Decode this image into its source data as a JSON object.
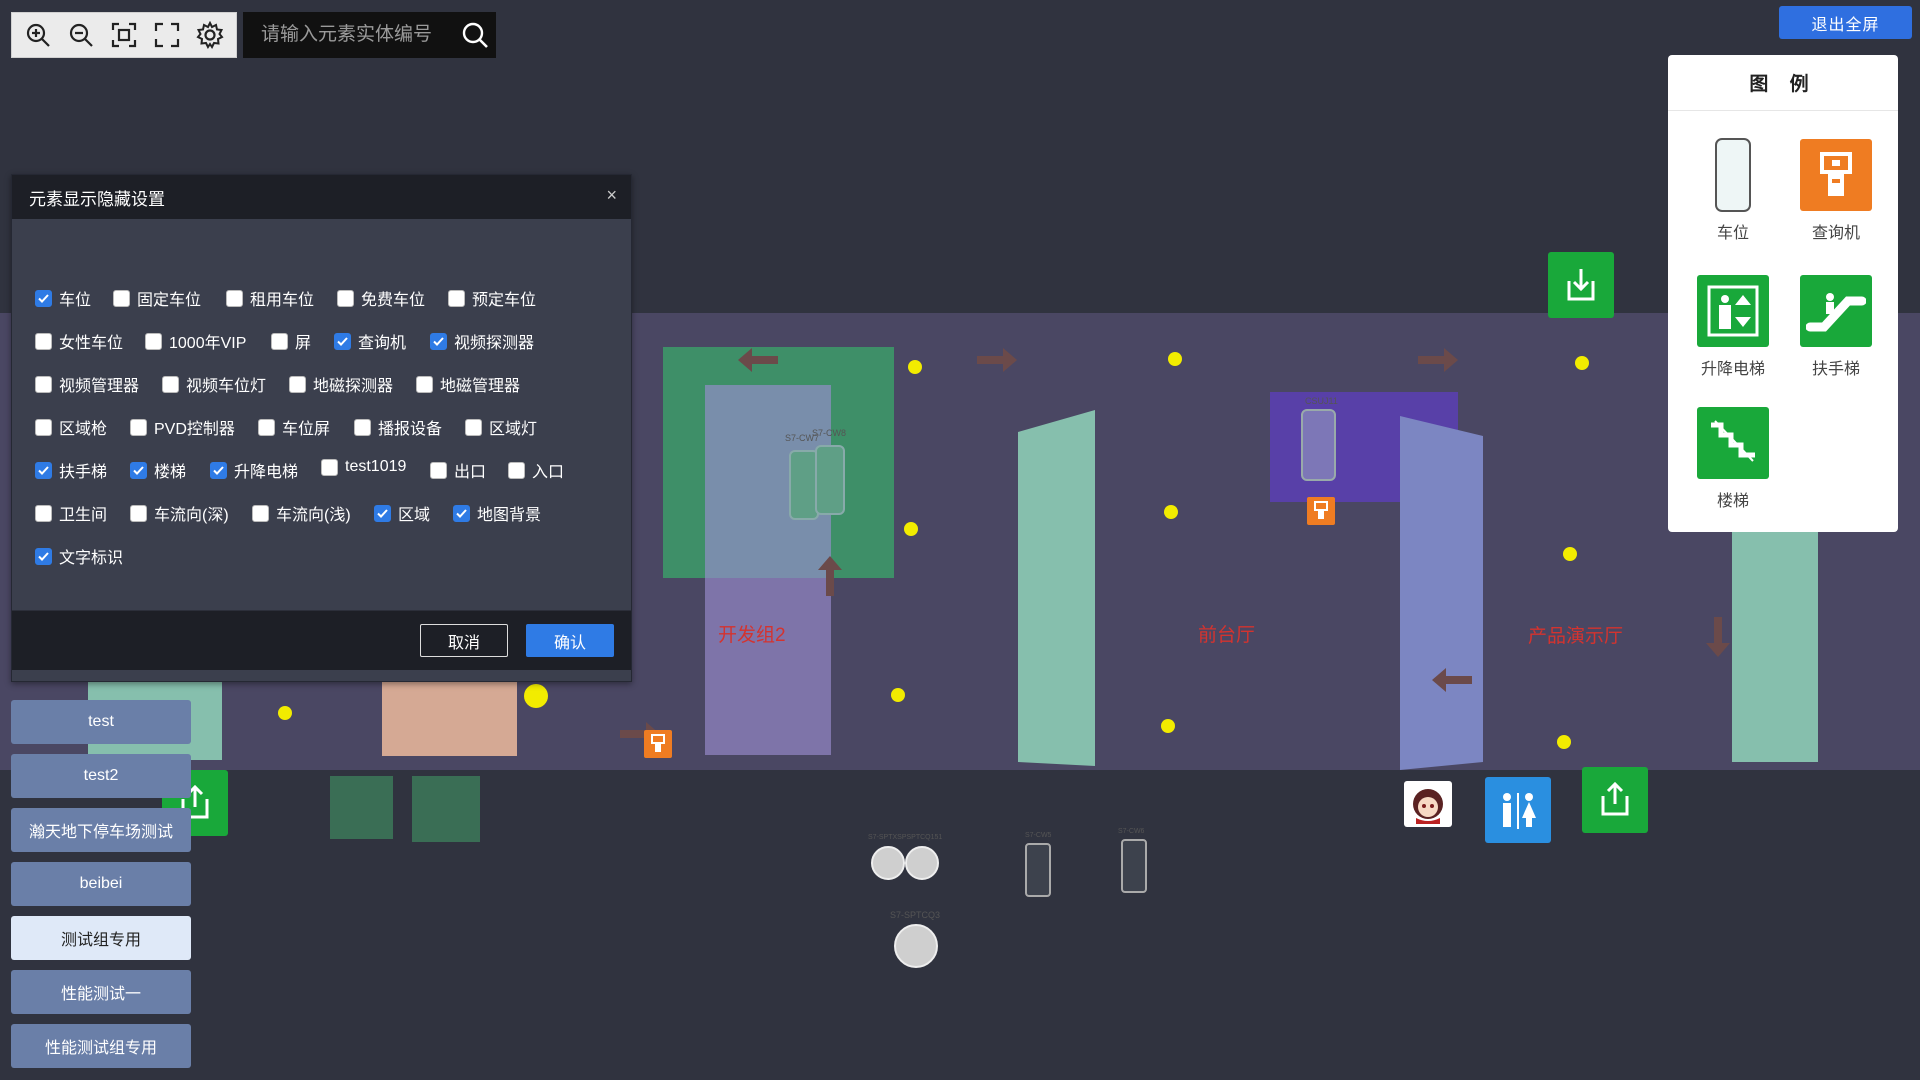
{
  "toolbar": {
    "zoom_in": "zoom-in-icon",
    "zoom_out": "zoom-out-icon",
    "fit": "fit-view-icon",
    "fullscreen": "fullscreen-icon",
    "settings": "gear-icon"
  },
  "search": {
    "placeholder": "请输入元素实体编号"
  },
  "exit_fullscreen": "退出全屏",
  "dialog": {
    "title": "元素显示隐藏设置",
    "close": "×",
    "cancel": "取消",
    "confirm": "确认",
    "options": [
      {
        "label": "车位",
        "checked": true
      },
      {
        "label": "固定车位",
        "checked": false
      },
      {
        "label": "租用车位",
        "checked": false
      },
      {
        "label": "免费车位",
        "checked": false
      },
      {
        "label": "预定车位",
        "checked": false
      },
      {
        "label": "女性车位",
        "checked": false
      },
      {
        "label": "1000年VIP",
        "checked": false
      },
      {
        "label": "屏",
        "checked": false
      },
      {
        "label": "查询机",
        "checked": true
      },
      {
        "label": "视频探测器",
        "checked": true
      },
      {
        "label": "视频管理器",
        "checked": false
      },
      {
        "label": "视频车位灯",
        "checked": false
      },
      {
        "label": "地磁探测器",
        "checked": false
      },
      {
        "label": "地磁管理器",
        "checked": false
      },
      {
        "label": "区域枪",
        "checked": false
      },
      {
        "label": "PVD控制器",
        "checked": false
      },
      {
        "label": "车位屏",
        "checked": false
      },
      {
        "label": "播报设备",
        "checked": false
      },
      {
        "label": "区域灯",
        "checked": false
      },
      {
        "label": "扶手梯",
        "checked": true
      },
      {
        "label": "楼梯",
        "checked": true
      },
      {
        "label": "升降电梯",
        "checked": true
      },
      {
        "label": "test1019",
        "checked": false
      },
      {
        "label": "出口",
        "checked": false
      },
      {
        "label": "入口",
        "checked": false
      },
      {
        "label": "卫生间",
        "checked": false
      },
      {
        "label": "车流向(深)",
        "checked": false
      },
      {
        "label": "车流向(浅)",
        "checked": false
      },
      {
        "label": "区域",
        "checked": true
      },
      {
        "label": "地图背景",
        "checked": true
      },
      {
        "label": "文字标识",
        "checked": true
      }
    ]
  },
  "groups": [
    {
      "label": "test",
      "active": false
    },
    {
      "label": "test2",
      "active": false
    },
    {
      "label": "瀚天地下停车场测试",
      "active": false
    },
    {
      "label": "beibei",
      "active": false
    },
    {
      "label": "测试组专用",
      "active": true
    },
    {
      "label": "性能测试一",
      "active": false
    },
    {
      "label": "性能测试组专用",
      "active": false
    }
  ],
  "legend": {
    "title": "图 例",
    "items": [
      {
        "label": "车位",
        "icon": "parking-space-icon"
      },
      {
        "label": "查询机",
        "icon": "kiosk-icon"
      },
      {
        "label": "升降电梯",
        "icon": "elevator-icon"
      },
      {
        "label": "扶手梯",
        "icon": "escalator-icon"
      },
      {
        "label": "楼梯",
        "icon": "stairs-icon"
      }
    ]
  },
  "map": {
    "zone_labels": [
      "开发组2",
      "前台厅",
      "产品演示厅"
    ],
    "small_labels": [
      "S7-CW7",
      "S7-CW8",
      "CSUJ11",
      "S7-SPTXSPSPTCQ151",
      "S7-CW5",
      "S7-CW6",
      "S7-SPTCQ3"
    ]
  },
  "colors": {
    "background": "#30333f",
    "map_band": "#4a4763",
    "accent_blue": "#2f7be5",
    "green_icon": "#19a83a",
    "orange_icon": "#ef7c22",
    "zone_label": "#d4332f",
    "dot_yellow": "#f2ec00"
  }
}
